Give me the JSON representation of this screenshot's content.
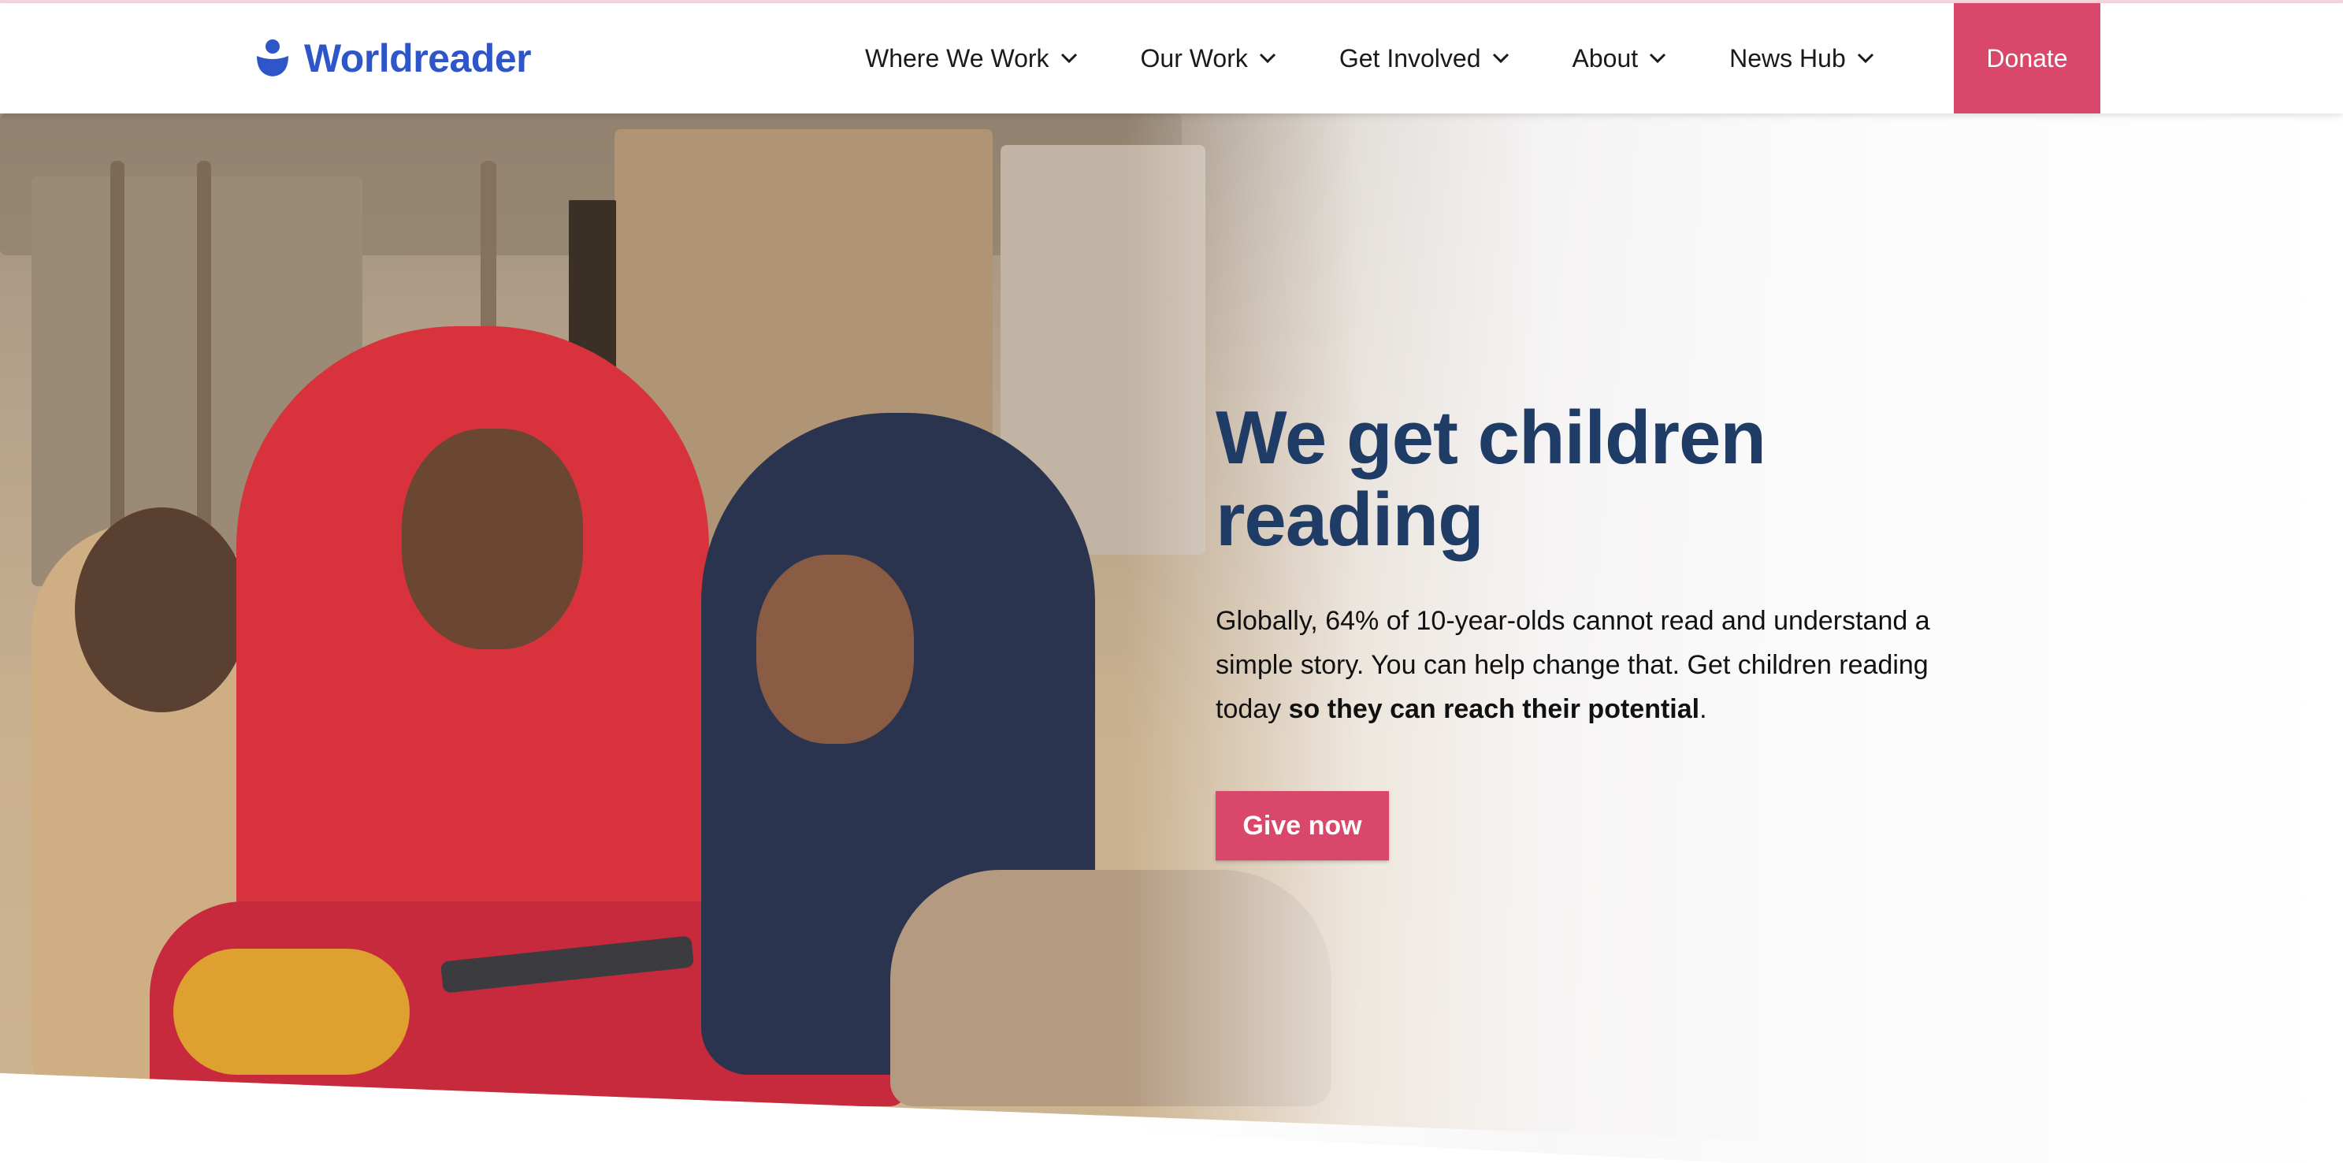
{
  "brand": {
    "name": "Worldreader",
    "color": "#2f56c9",
    "icon": "person-book-icon"
  },
  "nav": {
    "items": [
      {
        "label": "Where We Work"
      },
      {
        "label": "Our Work"
      },
      {
        "label": "Get Involved"
      },
      {
        "label": "About"
      },
      {
        "label": "News Hub"
      }
    ],
    "donate_label": "Donate",
    "accent": "#d9486b"
  },
  "hero": {
    "title": "We get children reading",
    "lead_prefix": "Globally, 64% of 10-year-olds cannot read and understand a simple story. You can help change that. Get children reading today ",
    "lead_bold": "so they can reach their potential",
    "lead_suffix": ".",
    "cta_label": "Give now",
    "title_color": "#1f3c66"
  }
}
